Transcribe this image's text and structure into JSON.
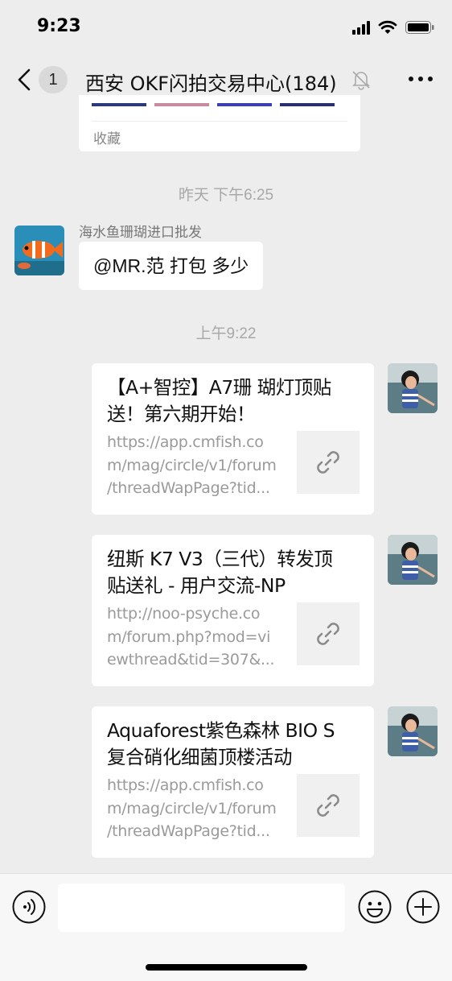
{
  "status_bar": {
    "time": "9:23"
  },
  "nav": {
    "unread_count": "1",
    "title": "西安 OKF闪拍交易中心(184)"
  },
  "top_card": {
    "footer": "收藏"
  },
  "timestamps": {
    "yesterday": "昨天 下午6:25",
    "morning": "上午9:22"
  },
  "message_1": {
    "sender": "海水鱼珊瑚进口批发",
    "text": "@MR.范 打包 多少"
  },
  "link_cards": [
    {
      "title_lines": [
        "【A+智控】A7珊 瑚灯顶贴",
        "送！第六期开始！"
      ],
      "desc_lines": [
        "https://app.cmfish.co",
        "m/mag/circle/v1/forum",
        "/threadWapPage?tid..."
      ]
    },
    {
      "title_lines": [
        "纽斯 K7 V3（三代）转发顶",
        "贴送礼 - 用户交流-NP"
      ],
      "desc_lines": [
        "http://noo-psyche.co",
        "m/forum.php?mod=vi",
        "ewthread&tid=307&..."
      ]
    },
    {
      "title_lines": [
        "Aquaforest紫色森林 BIO S",
        "复合硝化细菌顶楼活动"
      ],
      "desc_lines": [
        "https://app.cmfish.co",
        "m/mag/circle/v1/forum",
        "/threadWapPage?tid..."
      ]
    }
  ],
  "input": {
    "placeholder": ""
  },
  "colors": {
    "background": "#ededed",
    "bubble": "#ffffff",
    "muted_text": "#9a9a9a"
  }
}
